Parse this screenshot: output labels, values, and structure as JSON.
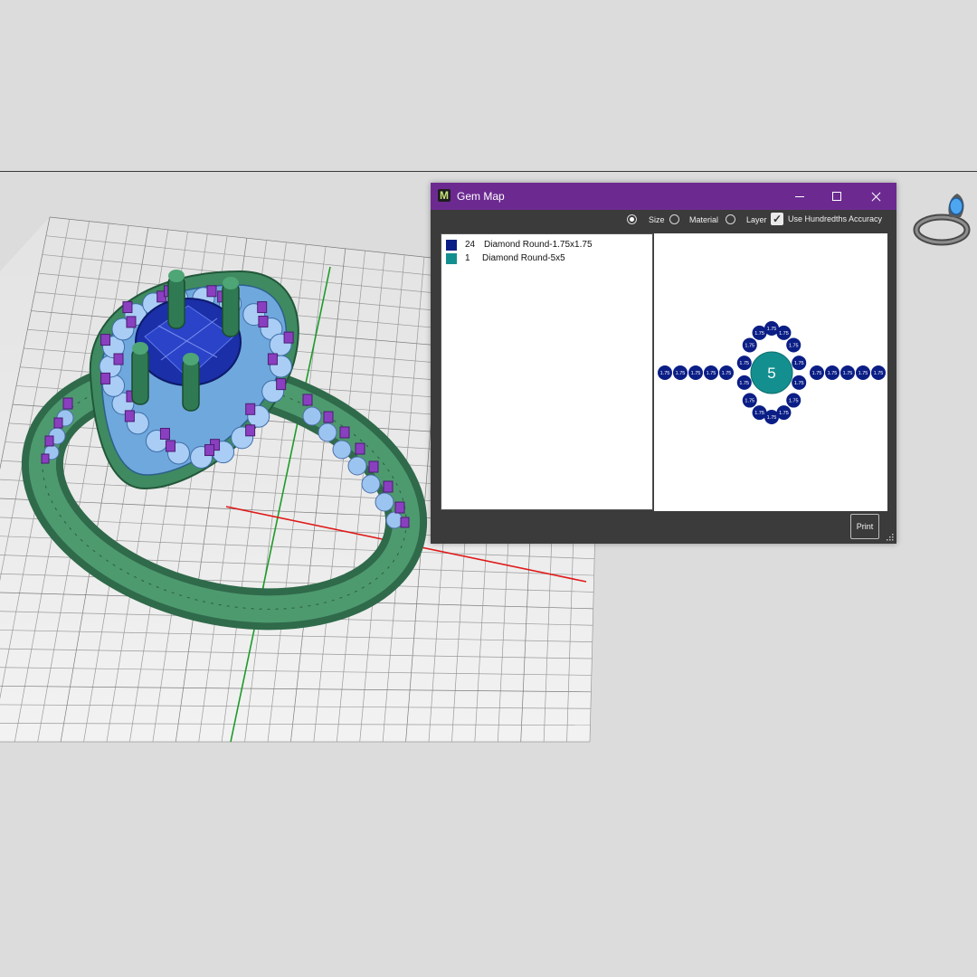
{
  "window": {
    "app_logo": "M",
    "title": "Gem Map",
    "controls": [
      "minimize-icon",
      "maximize-icon",
      "close-icon"
    ]
  },
  "toolbar": {
    "mode_options": [
      "Size",
      "Material",
      "Layer"
    ],
    "selected_mode": "Size",
    "hundredths_label": "Use Hundredths Accuracy",
    "hundredths_checked": true
  },
  "gem_list": [
    {
      "count": "24",
      "name": "Diamond Round-1.75x1.75",
      "color": "#0b1e86"
    },
    {
      "count": "1",
      "name": "Diamond Round-5x5",
      "color": "#148f8f"
    }
  ],
  "gem_map": {
    "center_label": "5",
    "small_label": "1.75",
    "center_color": "#148f8f",
    "small_color": "#0b1e86"
  },
  "actions": {
    "print_label": "Print"
  },
  "viewport": {
    "thumbnail_icon": "ring-preview-icon",
    "model_icon": "ring-model-icon"
  }
}
